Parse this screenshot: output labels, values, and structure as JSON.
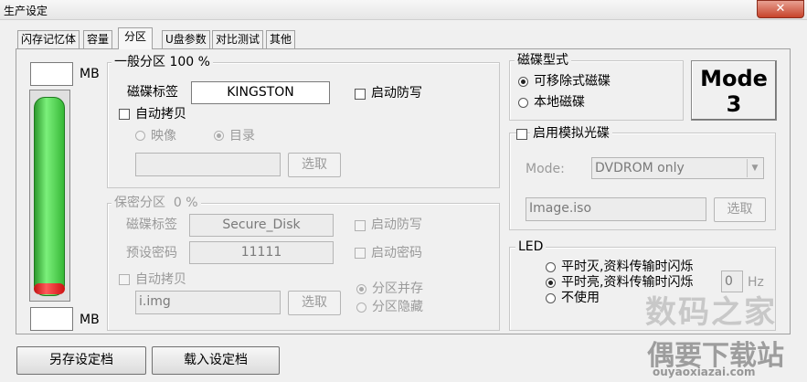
{
  "window": {
    "title": "生产设定",
    "close": "✕"
  },
  "tabs": [
    {
      "label": "闪存记忆体"
    },
    {
      "label": "容量"
    },
    {
      "label": "分区"
    },
    {
      "label": "U盘参数"
    },
    {
      "label": "对比测试"
    },
    {
      "label": "其他"
    }
  ],
  "capacity": {
    "top_value": "",
    "top_unit": "MB",
    "bottom_value": "",
    "bottom_unit": "MB"
  },
  "general_partition": {
    "legend": "一般分区",
    "percent": "100 %",
    "label_caption": "磁碟标签",
    "label_value": "KINGSTON",
    "write_protect": "启动防写",
    "auto_copy": "自动拷贝",
    "opt_image": "映像",
    "opt_dir": "目录",
    "path_value": "",
    "browse": "选取"
  },
  "secure_partition": {
    "legend": "保密分区",
    "percent": "0 %",
    "label_caption": "磁碟标签",
    "label_value": "Secure_Disk",
    "write_protect": "启动防写",
    "password_caption": "预设密码",
    "password_value": "11111",
    "enable_password": "启动密码",
    "auto_copy": "自动拷贝",
    "image_value": "i.img",
    "browse": "选取",
    "opt_coexist": "分区并存",
    "opt_hidden": "分区隐藏"
  },
  "disk_type": {
    "legend": "磁碟型式",
    "removable": "可移除式磁碟",
    "local": "本地磁碟"
  },
  "mode_box": {
    "line1": "Mode",
    "line2": "3"
  },
  "cdrom": {
    "checkbox": "启用模拟光碟",
    "mode_caption": "Mode:",
    "mode_value": "DVDROM only",
    "image_value": "Image.iso",
    "browse": "选取"
  },
  "led": {
    "legend": "LED",
    "opt1": "平时灭,资料传输时闪烁",
    "opt2": "平时亮,资料传输时闪烁",
    "opt3": "不使用",
    "hz_value": "0",
    "hz_unit": "Hz"
  },
  "footer": {
    "save": "另存设定档",
    "load": "载入设定档"
  },
  "watermark": {
    "line1": "数码之家",
    "line2": "偶要下载站",
    "line3": "ouyaoxiazai.com"
  }
}
